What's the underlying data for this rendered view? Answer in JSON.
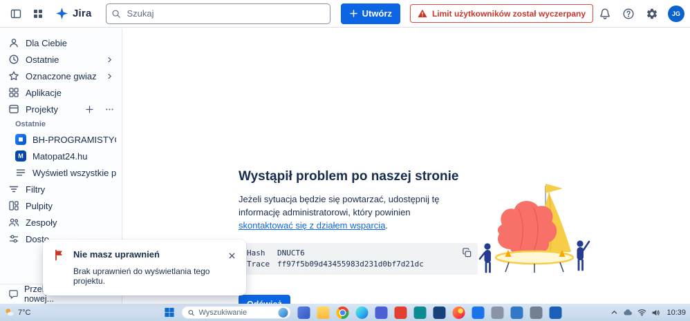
{
  "colors": {
    "accent_blue": "#0c66e4",
    "warning_red": "#c9372c",
    "text_primary": "#172b4d",
    "icon_gray": "#44546f",
    "code_block_bg": "#f1f2f4"
  },
  "icons": {
    "header": [
      "panel-left-icon",
      "app-grid-icon",
      "jira-logo-icon",
      "search-icon",
      "plus-icon",
      "warning-triangle-icon",
      "bell-icon",
      "question-circle-icon",
      "gear-icon"
    ],
    "sidebar": [
      "person-icon",
      "clock-icon",
      "star-icon",
      "grid-icon",
      "projects-icon",
      "list-icon",
      "filter-icon",
      "dashboard-icon",
      "people-icon",
      "customize-icon",
      "speech-bubble-icon",
      "chevron-right-icon",
      "more-icon"
    ],
    "main": [
      "copy-icon",
      "boat-error-illustration"
    ],
    "toast": [
      "flag-icon",
      "close-icon"
    ],
    "taskbar": [
      "weather-sun-icon",
      "windows-start-icon",
      "search-icon",
      "chevron-up-icon",
      "cloud-icon",
      "wifi-icon",
      "volume-icon"
    ]
  },
  "header": {
    "logo_text": "Jira",
    "search_placeholder": "Szukaj",
    "create_label": "Utwórz",
    "warning_label": "Limit użytkowników został wyczerpany",
    "avatar_initials": "JG"
  },
  "sidebar": {
    "items": [
      {
        "label": "Dla Ciebie"
      },
      {
        "label": "Ostatnie"
      },
      {
        "label": "Oznaczone gwiazdką"
      },
      {
        "label": "Aplikacje"
      },
      {
        "label": "Projekty"
      }
    ],
    "recent_heading": "Ostatnie",
    "recent_projects": [
      {
        "label": "BH-PROGRAMISTYCZ...",
        "avatar_letter": ""
      },
      {
        "label": "Matopat24.hu",
        "avatar_letter": "M"
      },
      {
        "label": "Wyświetl wszystkie pr..."
      }
    ],
    "secondary_items": [
      {
        "label": "Filtry"
      },
      {
        "label": "Pulpity"
      },
      {
        "label": "Zespoły"
      },
      {
        "label": "Dosto"
      }
    ],
    "feedback_label": "Przekaż opinię o nowej..."
  },
  "main": {
    "title": "Wystąpił problem po naszej stronie",
    "desc_text": "Jeżeli sytuacja będzie się powtarzać, udostępnij tę informację administratorowi, który powinien ",
    "desc_link": "skontaktować się z działem wsparcia",
    "desc_end": ".",
    "hash_label": "Hash",
    "hash_value": "DNUCT6",
    "trace_label": "Trace",
    "trace_value": "ff97f5b09d43455983d231d0bf7d21dc",
    "refresh_label": "Odśwież"
  },
  "toast": {
    "title": "Nie masz uprawnień",
    "message": "Brak uprawnień do wyświetlania tego projektu."
  },
  "taskbar": {
    "weather_temp": "7°C",
    "search_placeholder": "Wyszukiwanie",
    "clock_time": "10:39",
    "apps": [
      {
        "name": "app-icon-blue",
        "css": "background:linear-gradient(135deg,#5a7fe0,#3659c4);border-radius:4px"
      },
      {
        "name": "file-explorer-icon",
        "css": "background:linear-gradient(180deg,#ffd969,#fcb83a);border-radius:3px"
      },
      {
        "name": "chrome-icon",
        "css": "border-radius:50%;background:radial-gradient(circle,#4285f4 0 28%,#fff 28% 38%,rgba(0,0,0,0) 38%),conic-gradient(from -45deg,#ea4335 0 33%,#34a853 33% 66%,#fbbc05 66% 100%)"
      },
      {
        "name": "edge-icon",
        "css": "border-radius:50%;background:linear-gradient(135deg,#6df0c2 0%,#35c1f1 45%,#1b6fd0 100%)"
      },
      {
        "name": "app-icon-indigo",
        "css": "background:#4c5fd5;border-radius:4px"
      },
      {
        "name": "app-icon-red",
        "css": "background:#e23f33;border-radius:4px"
      },
      {
        "name": "app-icon-teal",
        "css": "background:#0b8a8f;border-radius:4px"
      },
      {
        "name": "app-icon-navy",
        "css": "background:#15427a;border-radius:4px"
      },
      {
        "name": "firefox-icon",
        "css": "border-radius:50%;background:radial-gradient(circle at 65% 35%,#ffe14d 0 22%,rgba(0,0,0,0) 22%),linear-gradient(135deg,#ff9640,#ff3d3d 70%,#b5007f)"
      },
      {
        "name": "app-icon-blue2",
        "css": "background:#1a73e8;border-radius:4px"
      },
      {
        "name": "app-icon-gray",
        "css": "background:#8a94a6;border-radius:4px"
      },
      {
        "name": "app-icon-steel",
        "css": "background:#3178c6;border-radius:4px"
      },
      {
        "name": "settings-app-icon",
        "css": "background:#73808f;border-radius:4px"
      },
      {
        "name": "app-icon-cobalt",
        "css": "background:#1b5fb8;border-radius:4px"
      }
    ]
  }
}
